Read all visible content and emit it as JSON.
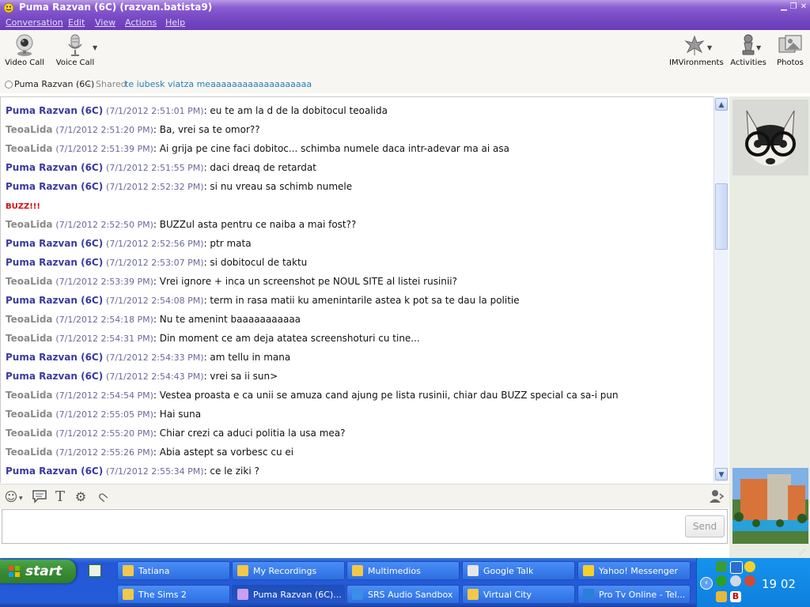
{
  "window": {
    "title": "Puma Razvan (6C) (razvan.batista9)",
    "menu": [
      "Conversation",
      "Edit",
      "View",
      "Actions",
      "Help"
    ]
  },
  "toolbar": {
    "video_call": "Video Call",
    "voice_call": "Voice Call",
    "imvironments": "IMVironments",
    "activities": "Activities",
    "photos": "Photos"
  },
  "status": {
    "contact": "Puma Razvan (6C)",
    "separator": "-",
    "shared_label": "Shared",
    "shared_message": "te iubesk viatza meaaaaaaaaaaaaaaaaaaa"
  },
  "chat": {
    "messages": [
      {
        "who": "Puma Razvan (6C)",
        "ts": "(7/1/2012 2:51:01 PM)",
        "text": ": eu te am la d de la dobitocul teoalida"
      },
      {
        "who": "TeoaLida",
        "ts": "(7/1/2012 2:51:20 PM)",
        "text": ": Ba, vrei sa te omor??"
      },
      {
        "who": "TeoaLida",
        "ts": "(7/1/2012 2:51:39 PM)",
        "text": ": Ai grija pe cine faci dobitoc... schimba numele daca intr-adevar ma ai asa"
      },
      {
        "who": "Puma Razvan (6C)",
        "ts": "(7/1/2012 2:51:55 PM)",
        "text": ": daci dreaq de retardat"
      },
      {
        "who": "Puma Razvan (6C)",
        "ts": "(7/1/2012 2:52:32 PM)",
        "text": ": si nu vreau sa schimb numele"
      },
      {
        "buzz": "BUZZ!!!"
      },
      {
        "who": "TeoaLida",
        "ts": "(7/1/2012 2:52:50 PM)",
        "text": ": BUZZul asta pentru ce naiba a mai fost??"
      },
      {
        "who": "Puma Razvan (6C)",
        "ts": "(7/1/2012 2:52:56 PM)",
        "text": ": ptr mata"
      },
      {
        "who": "Puma Razvan (6C)",
        "ts": "(7/1/2012 2:53:07 PM)",
        "text": ": si dobitocul de taktu"
      },
      {
        "who": "TeoaLida",
        "ts": "(7/1/2012 2:53:39 PM)",
        "text": ": Vrei ignore + inca un screenshot pe NOUL SITE al listei rusinii?"
      },
      {
        "who": "Puma Razvan (6C)",
        "ts": "(7/1/2012 2:54:08 PM)",
        "text": ": term in rasa matii ku amenintarile astea k pot sa te dau la politie"
      },
      {
        "who": "TeoaLida",
        "ts": "(7/1/2012 2:54:18 PM)",
        "text": ": Nu te amenint baaaaaaaaaaa"
      },
      {
        "who": "TeoaLida",
        "ts": "(7/1/2012 2:54:31 PM)",
        "text": ": Din moment ce am deja atatea screenshoturi cu tine..."
      },
      {
        "who": "Puma Razvan (6C)",
        "ts": "(7/1/2012 2:54:33 PM)",
        "text": ": am tellu in mana"
      },
      {
        "who": "Puma Razvan (6C)",
        "ts": "(7/1/2012 2:54:43 PM)",
        "text": ": vrei sa ii sun>"
      },
      {
        "who": "TeoaLida",
        "ts": "(7/1/2012 2:54:54 PM)",
        "text": ": Vestea proasta e ca unii se amuza cand ajung pe lista rusinii, chiar dau BUZZ special ca sa-i pun"
      },
      {
        "who": "TeoaLida",
        "ts": "(7/1/2012 2:55:05 PM)",
        "text": ": Hai suna"
      },
      {
        "who": "TeoaLida",
        "ts": "(7/1/2012 2:55:20 PM)",
        "text": ": Chiar crezi ca aduci politia la usa mea?"
      },
      {
        "who": "TeoaLida",
        "ts": "(7/1/2012 2:55:26 PM)",
        "text": ": Abia astept sa vorbesc cu ei"
      },
      {
        "who": "Puma Razvan (6C)",
        "ts": "(7/1/2012 2:55:34 PM)",
        "text": ": ce le ziki ?"
      }
    ]
  },
  "compose": {
    "send_label": "Send",
    "value": ""
  },
  "taskbar": {
    "start_label": "start",
    "tasks_row1": [
      "Tatiana",
      "My Recordings",
      "Multimedios",
      "Google Talk",
      "Yahoo! Messenger"
    ],
    "tasks_row2": [
      "The Sims 2",
      "Puma Razvan (6C)...",
      "SRS Audio Sandbox",
      "Virtual City",
      "Pro Tv Online - Tel..."
    ],
    "clock": "19 02"
  },
  "colors": {
    "contact_name": "#3a3aa0",
    "self_name": "#8a8a8a",
    "buzz": "#d01010",
    "title_purple": "#7a4cc6",
    "xp_blue": "#245bd8",
    "status_link": "#2a7fb8"
  },
  "icons": {
    "video_call": "webcam-icon",
    "voice_call": "microphone-icon",
    "imvironments": "leaves-icon",
    "activities": "chess-piece-icon",
    "photos": "photos-icon",
    "emoticon": "smiley-icon",
    "buzz": "speech-bubble-icon",
    "format": "text-format-icon",
    "settings": "gear-icon",
    "attach": "paperclip-icon",
    "add_contact": "add-person-icon"
  }
}
